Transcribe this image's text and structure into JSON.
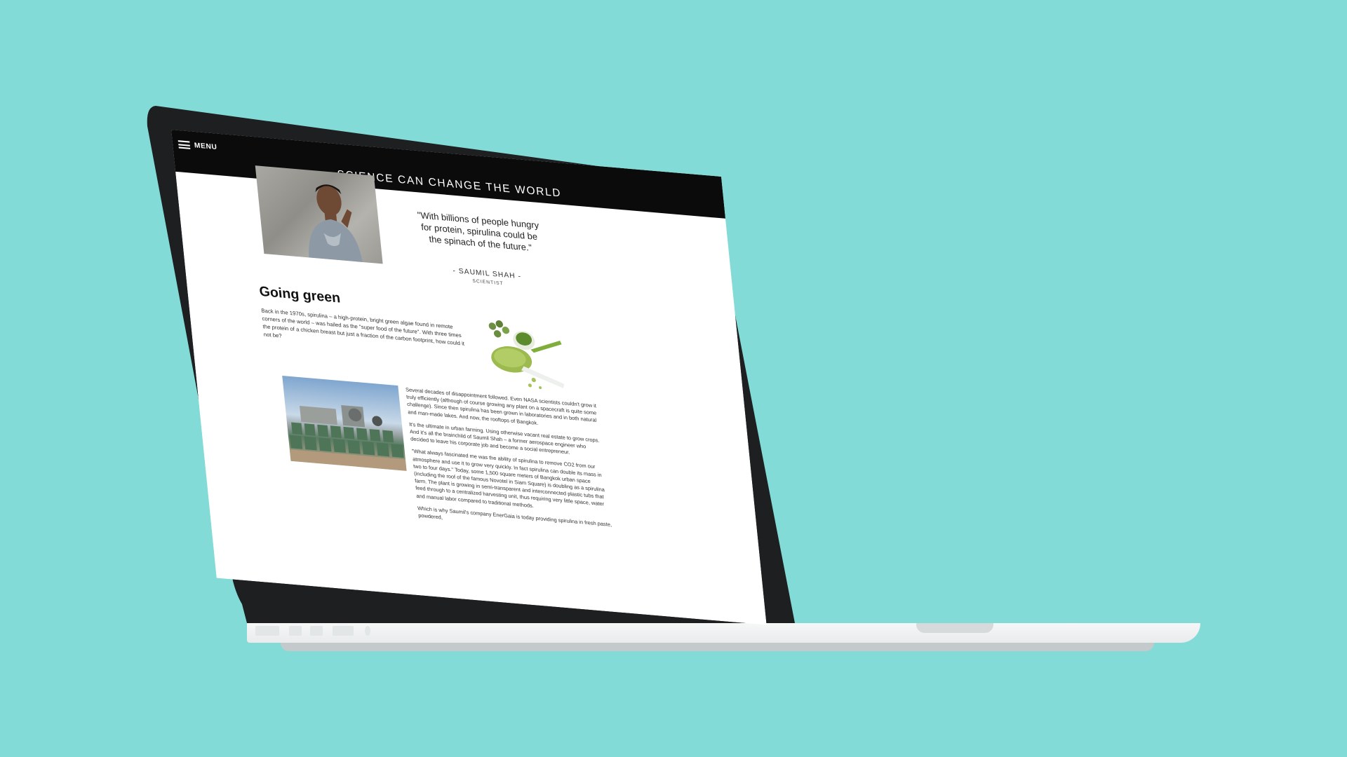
{
  "menu": {
    "label": "MENU"
  },
  "site": {
    "title": "SCIENCE CAN CHANGE THE WORLD"
  },
  "quote": {
    "text": "\"With billions of people hungry for protein, spirulina could be the spinach of the future.\"",
    "attribution": "- SAUMIL SHAH -",
    "role": "SCIENTIST"
  },
  "article": {
    "heading": "Going green",
    "intro": "Back in the 1970s, spirulina – a high-protein, bright green algae found in remote corners of the world – was hailed as the \"super food of the future\". With three times the protein of a chicken breast but just a fraction of the carbon footprint, how could it not be?",
    "paragraphs": [
      "Several decades of disappointment followed. Even NASA scientists couldn't grow it truly efficiently (although of course growing any plant on a spacecraft is quite some challenge). Since then spirulina has been grown in laboratories and in both natural and man-made lakes. And now, the rooftops of Bangkok.",
      "It's the ultimate in urban farming. Using otherwise vacant real estate to grow crops. And it's all the brainchild of Saumil Shah – a former aerospace engineer who decided to leave his corporate job and become a social entrepreneur.",
      "\"What always fascinated me was the ability of spirulina to remove CO2 from our atmosphere and use it to grow very quickly. In fact spirulina can double its mass in two to four days.\" Today, some 1,500 square meters of Bangkok urban space (including the roof of the famous Novotel in Siam Square) is doubling as a spirulina farm. The plant is growing in semi-transparent and interconnected plastic tubs that feed through to a centralized harvesting unit, thus requiring very little space, water and manual labor compared to traditional methods.",
      "Which is why Saumil's company EnerGaia is today providing spirulina in fresh paste, powdered,"
    ]
  },
  "colors": {
    "background": "#83dbd8",
    "bezel": "#1d1f21",
    "topbar": "#0b0b0b"
  }
}
